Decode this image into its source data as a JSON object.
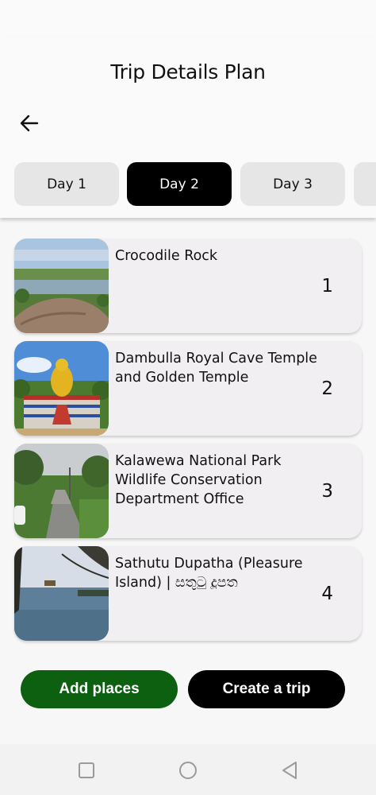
{
  "header": {
    "title": "Trip Details Plan"
  },
  "tabs": [
    {
      "label": "Day 1",
      "active": false
    },
    {
      "label": "Day 2",
      "active": true
    },
    {
      "label": "Day 3",
      "active": false
    }
  ],
  "places": [
    {
      "name": "Crocodile Rock",
      "number": "1"
    },
    {
      "name": "Dambulla Royal Cave Temple and Golden Temple",
      "number": "2"
    },
    {
      "name": "Kalawewa National Park Wildlife Conservation Department Office",
      "number": "3"
    },
    {
      "name": "Sathutu Dupatha (Pleasure Island) | සතුටු දූපත",
      "number": "4"
    }
  ],
  "actions": {
    "add_places": "Add places",
    "create_trip": "Create a trip"
  },
  "colors": {
    "active_tab": "#000000",
    "add_button": "#0c6010",
    "create_button": "#000000",
    "card_bg": "#f1eff1"
  },
  "icons": {
    "back": "arrow-left-icon",
    "nav_recent": "square-icon",
    "nav_home": "circle-icon",
    "nav_back": "triangle-left-icon"
  }
}
